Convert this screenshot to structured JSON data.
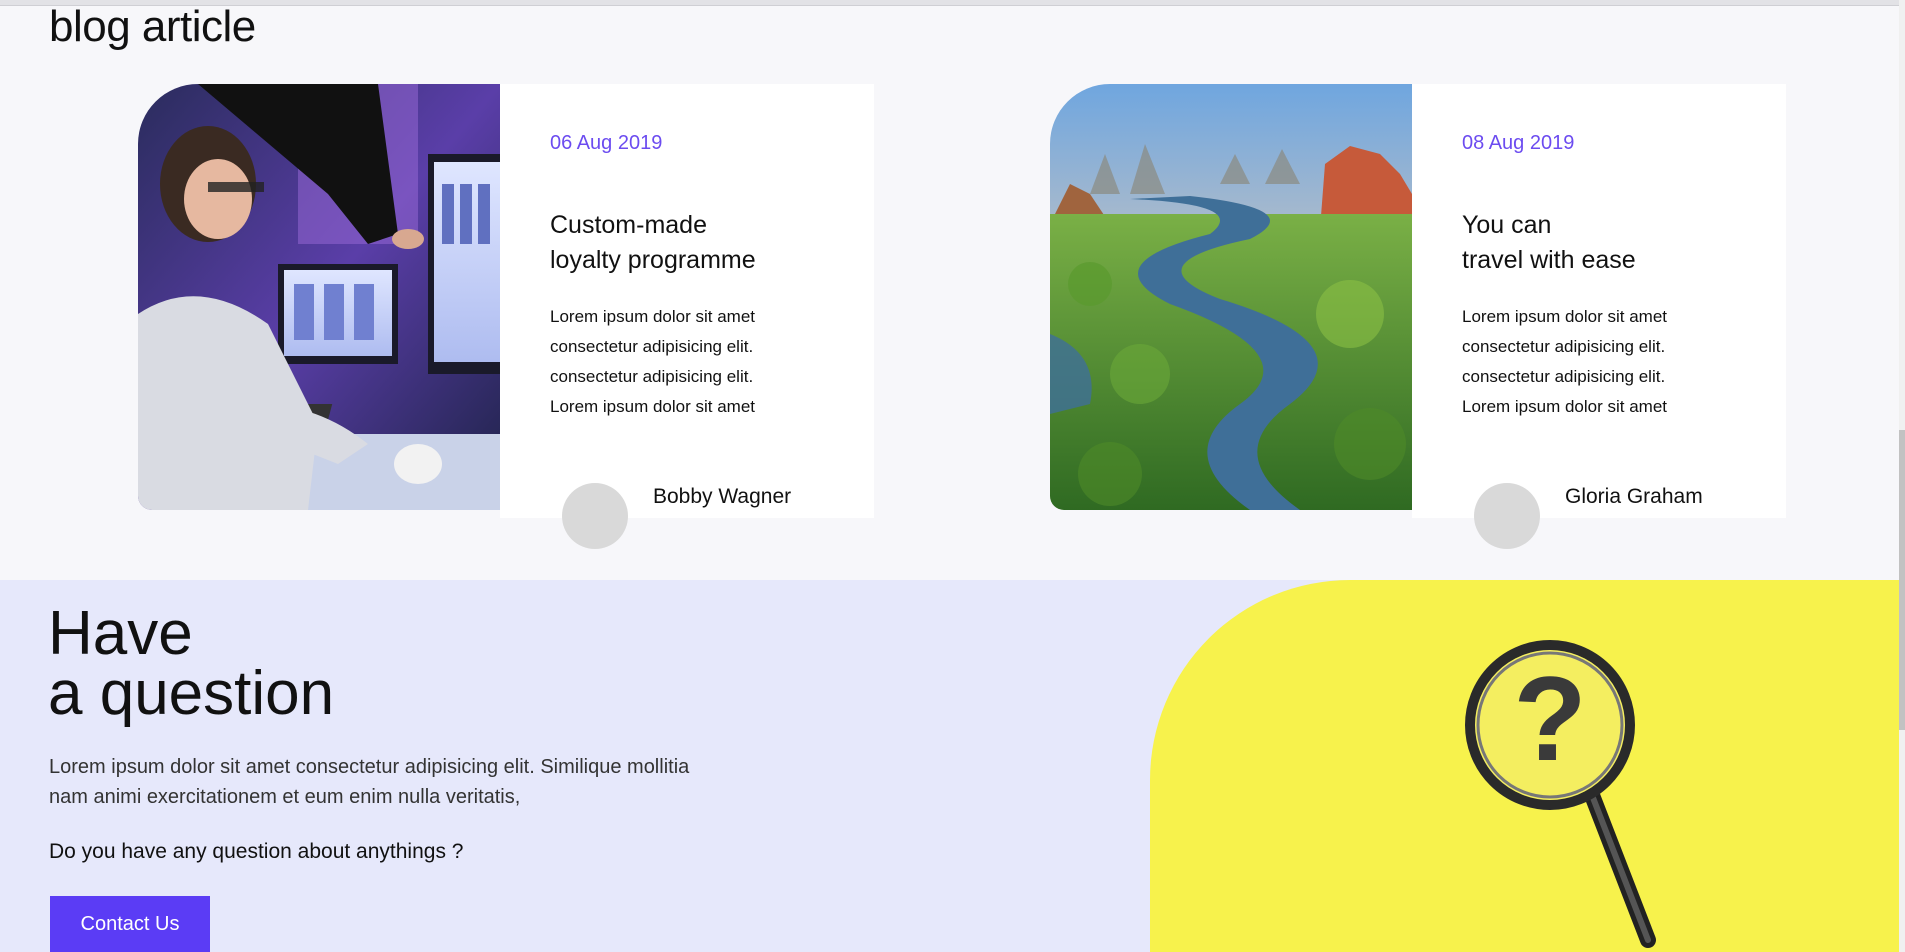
{
  "blog": {
    "heading": "blog article",
    "cards": [
      {
        "date": "06 Aug 2019",
        "title_line1": "Custom-made",
        "title_line2": "loyalty programme",
        "text_lines": [
          "Lorem ipsum dolor sit amet",
          "consectetur adipisicing elit.",
          "consectetur adipisicing elit.",
          "Lorem ipsum dolor sit amet"
        ],
        "author": "Bobby Wagner"
      },
      {
        "date": "08 Aug 2019",
        "title_line1": "You can",
        "title_line2": "travel with ease",
        "text_lines": [
          "Lorem ipsum dolor sit amet",
          "consectetur adipisicing elit.",
          "consectetur adipisicing elit.",
          "Lorem ipsum dolor sit amet"
        ],
        "author": "Gloria Graham"
      }
    ]
  },
  "question": {
    "heading_line1": "Have",
    "heading_line2": "a question",
    "text_line1": "Lorem ipsum dolor sit amet consectetur adipisicing elit. Similique mollitia",
    "text_line2": "nam animi exercitationem et eum enim nulla veritatis,",
    "prompt": "Do you have any question about anythings ?",
    "button_label": "Contact Us"
  },
  "colors": {
    "accent": "#5b3cf5",
    "date": "#6c4cf0",
    "question_bg": "#e6e8fb",
    "yellow": "#f7f24c"
  }
}
